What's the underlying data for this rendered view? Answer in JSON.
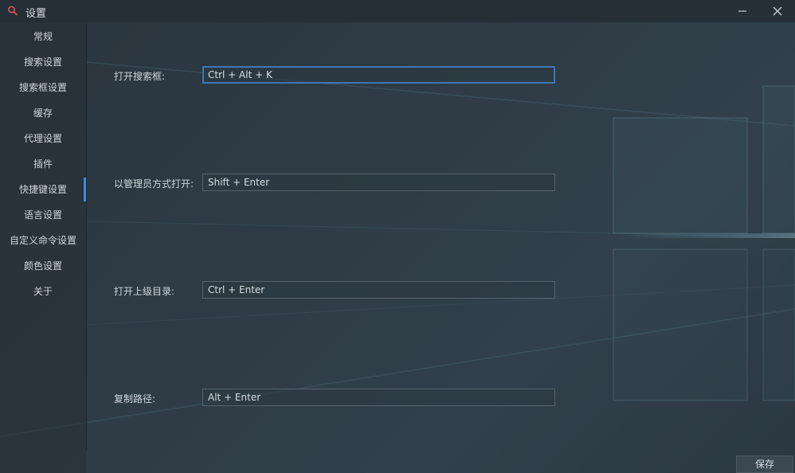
{
  "window": {
    "title": "设置",
    "app_icon": "search-icon",
    "minimize_icon": "minimize-icon",
    "close_icon": "close-icon"
  },
  "sidebar": {
    "items": [
      {
        "label": "常规"
      },
      {
        "label": "搜索设置"
      },
      {
        "label": "搜索框设置"
      },
      {
        "label": "缓存"
      },
      {
        "label": "代理设置"
      },
      {
        "label": "插件"
      },
      {
        "label": "快捷键设置",
        "selected": true
      },
      {
        "label": "语言设置"
      },
      {
        "label": "自定义命令设置"
      },
      {
        "label": "颜色设置"
      },
      {
        "label": "关于"
      }
    ]
  },
  "hotkeys": {
    "open_search": {
      "label": "打开搜索框:",
      "value": "Ctrl + Alt + K"
    },
    "open_as_admin": {
      "label": "以管理员方式打开:",
      "value": "Shift + Enter"
    },
    "open_parent_dir": {
      "label": "打开上级目录:",
      "value": "Ctrl + Enter"
    },
    "copy_path": {
      "label": "复制路径:",
      "value": "Alt + Enter"
    }
  },
  "footer": {
    "save_label": "保存"
  },
  "colors": {
    "accent": "#3d8ee0",
    "background": "#2c3841",
    "titlebar": "#252f37",
    "title_icon": "#d9534f"
  }
}
